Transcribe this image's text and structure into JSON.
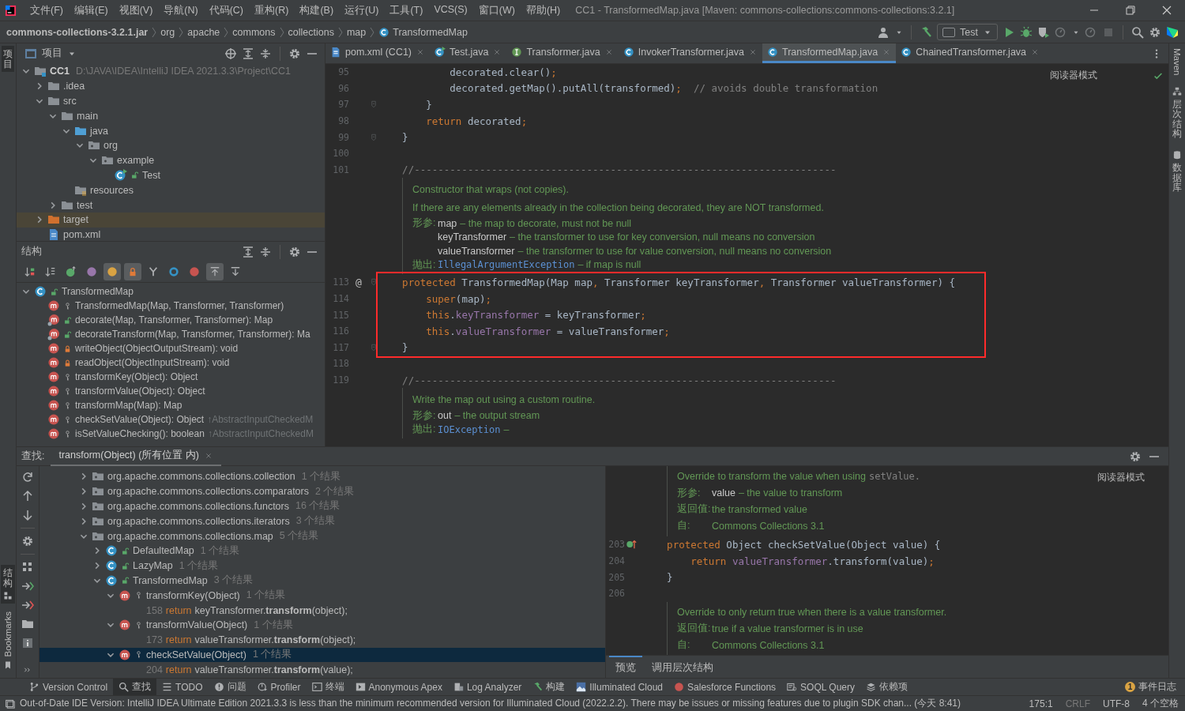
{
  "menu": [
    "文件(F)",
    "编辑(E)",
    "视图(V)",
    "导航(N)",
    "代码(C)",
    "重构(R)",
    "构建(B)",
    "运行(U)",
    "工具(T)",
    "VCS(S)",
    "窗口(W)",
    "帮助(H)"
  ],
  "window_title": "CC1 - TransformedMap.java [Maven: commons-collections:commons-collections:3.2.1]",
  "breadcrumbs": [
    "commons-collections-3.2.1.jar",
    "org",
    "apache",
    "commons",
    "collections",
    "map",
    "TransformedMap"
  ],
  "run_config": "Test",
  "left_top_tabs": [
    {
      "label": "项目",
      "kind": "stacked",
      "selected": true
    }
  ],
  "left_bottom_tabs": [
    {
      "label": "结构",
      "kind": "stacked",
      "selected": true
    },
    {
      "label": "Bookmarks",
      "kind": "rotated",
      "selected": false
    }
  ],
  "right_tabs": [
    {
      "label": "Maven",
      "kind": "rotated",
      "selected": false
    },
    {
      "label": "层次结构",
      "kind": "stacked",
      "selected": false
    },
    {
      "label": "数据库",
      "kind": "stacked",
      "selected": false
    }
  ],
  "project": {
    "title": "项目",
    "tree": [
      {
        "kind": "module",
        "label": "CC1",
        "path": "D:\\JAVA\\IDEA\\IntelliJ IDEA 2021.3.3\\Project\\CC1",
        "expanded": true,
        "selected": false,
        "children": [
          {
            "kind": "folder",
            "label": ".idea",
            "expanded": false,
            "selected": false
          },
          {
            "kind": "folder",
            "label": "src",
            "expanded": true,
            "selected": false,
            "children": [
              {
                "kind": "folder",
                "label": "main",
                "expanded": true,
                "selected": false,
                "children": [
                  {
                    "kind": "source",
                    "label": "java",
                    "expanded": true,
                    "selected": false,
                    "children": [
                      {
                        "kind": "package",
                        "label": "org",
                        "expanded": true,
                        "selected": false,
                        "children": [
                          {
                            "kind": "package",
                            "label": "example",
                            "expanded": true,
                            "selected": false,
                            "children": [
                              {
                                "kind": "runclass",
                                "label": "Test",
                                "public": true,
                                "private": false,
                                "selected": false
                              }
                            ]
                          }
                        ]
                      }
                    ]
                  },
                  {
                    "kind": "resources",
                    "label": "resources",
                    "selected": false
                  }
                ]
              },
              {
                "kind": "folder",
                "label": "test",
                "expanded": false,
                "selected": false
              }
            ]
          },
          {
            "kind": "excluded",
            "label": "target",
            "expanded": false,
            "selected": true
          },
          {
            "kind": "xmlfile",
            "label": "pom.xml",
            "selected": false
          }
        ]
      }
    ]
  },
  "structure": {
    "title": "结构",
    "toolbar": [
      {
        "on": false
      },
      {
        "on": false
      },
      {
        "on": false
      },
      {
        "on": false
      },
      {
        "on": true
      },
      {
        "on": true
      },
      {
        "on": false
      },
      {
        "on": false
      },
      {
        "on": false
      },
      {
        "on": true
      },
      {
        "on": false
      }
    ],
    "tree": [
      {
        "kind": "class",
        "label": "TransformedMap",
        "public": true,
        "private": false,
        "expanded": true,
        "selected": false,
        "children": [
          {
            "kind": "method",
            "label": "TransformedMap(Map, Transformer, Transformer)",
            "public": false,
            "private": false,
            "static": false,
            "selected": false
          },
          {
            "kind": "method",
            "label": "decorate(Map, Transformer, Transformer): Map",
            "public": true,
            "private": false,
            "static": true,
            "selected": false
          },
          {
            "kind": "method",
            "label": "decorateTransform(Map, Transformer, Transformer): Ma",
            "public": true,
            "private": false,
            "static": true,
            "selected": false
          },
          {
            "kind": "method",
            "label": "writeObject(ObjectOutputStream): void",
            "public": false,
            "private": true,
            "static": false,
            "selected": false
          },
          {
            "kind": "method",
            "label": "readObject(ObjectInputStream): void",
            "public": false,
            "private": true,
            "static": false,
            "selected": false
          },
          {
            "kind": "method",
            "label": "transformKey(Object): Object",
            "public": false,
            "private": false,
            "static": false,
            "selected": false
          },
          {
            "kind": "method",
            "label": "transformValue(Object): Object",
            "public": false,
            "private": false,
            "static": false,
            "selected": false
          },
          {
            "kind": "method",
            "label": "transformMap(Map): Map",
            "public": false,
            "private": false,
            "static": false,
            "selected": false
          },
          {
            "kind": "method",
            "label": "checkSetValue(Object): Object",
            "suffix": "↑AbstractInputCheckedM",
            "public": false,
            "private": false,
            "static": false,
            "selected": false
          },
          {
            "kind": "method",
            "label": "isSetValueChecking(): boolean",
            "suffix": "↑AbstractInputCheckedM",
            "public": false,
            "private": false,
            "static": false,
            "selected": false
          }
        ]
      }
    ]
  },
  "editor": {
    "tabs": [
      {
        "label": "pom.xml (CC1)",
        "kind": "xmlfile",
        "selected": false
      },
      {
        "label": "Test.java",
        "kind": "runclass",
        "selected": false
      },
      {
        "label": "Transformer.java",
        "kind": "interface",
        "selected": false
      },
      {
        "label": "InvokerTransformer.java",
        "kind": "class",
        "selected": false
      },
      {
        "label": "TransformedMap.java",
        "kind": "class",
        "selected": true
      },
      {
        "label": "ChainedTransformer.java",
        "kind": "class",
        "selected": false
      }
    ],
    "reader_mode": "阅读器模式",
    "segments": [
      {
        "kind": "code",
        "highlighted": false,
        "lines": [
          {
            "num": "95",
            "text": "            decorated.clear()**;**"
          },
          {
            "num": "96",
            "text": "            decorated.getMap().putAll(transformed)**;**",
            "comment": "  // avoids double transformation"
          },
          {
            "num": "97",
            "fold": true,
            "text": "        }"
          },
          {
            "num": "98",
            "text": "        **return** decorated**;**"
          },
          {
            "num": "99",
            "fold": true,
            "text": "    }"
          },
          {
            "num": "100"
          },
          {
            "num": "101",
            "comment": "    //-----------------------------------------------------------------------"
          }
        ]
      },
      {
        "kind": "doc",
        "items": [
          {
            "kind": "text",
            "text": "Constructor that wraps (not copies)."
          },
          {
            "kind": "text",
            "text": "If there are any elements already in the collection being decorated, they are NOT transformed."
          },
          {
            "kind": "tag",
            "label": "形参:",
            "name": "map",
            "desc": "– the map to decorate, must not be null"
          },
          {
            "kind": "tag",
            "name": "keyTransformer",
            "desc": "– the transformer to use for key conversion, null means no conversion"
          },
          {
            "kind": "tag",
            "name": "valueTransformer",
            "desc": "– the transformer to use for value conversion, null means no conversion"
          },
          {
            "kind": "tag",
            "label": "抛出:",
            "code": "IllegalArgumentException",
            "desc": "– if map is null"
          }
        ]
      },
      {
        "kind": "code",
        "highlighted": true,
        "lines": [
          {
            "num": "113",
            "gutter": "@",
            "fold": true,
            "text": "    **protected** TransformedMap(Map map**,** Transformer keyTransformer**,** Transformer valueTransformer) {"
          },
          {
            "num": "114",
            "text": "        **super**(map)**;**"
          },
          {
            "num": "115",
            "text": "        **this**.*keyTransformer* = keyTransformer**;**"
          },
          {
            "num": "116",
            "text": "        **this**.*valueTransformer* = valueTransformer**;**"
          },
          {
            "num": "117",
            "fold": true,
            "text": "    }"
          }
        ]
      },
      {
        "kind": "code",
        "highlighted": false,
        "lines": [
          {
            "num": "118"
          },
          {
            "num": "119",
            "comment": "    //-----------------------------------------------------------------------"
          }
        ]
      },
      {
        "kind": "doc",
        "items": [
          {
            "kind": "text",
            "text": "Write the map out using a custom routine."
          },
          {
            "kind": "tag",
            "label": "形参:",
            "name": "out",
            "desc": "– the output stream"
          },
          {
            "kind": "tag",
            "label": "抛出:",
            "code": "IOException",
            "desc": "–"
          }
        ]
      }
    ]
  },
  "find": {
    "label": "查找:",
    "tab": "transform(Object) (所有位置 内)",
    "tree": [
      {
        "kind": "package",
        "label": "org.apache.commons.collections.collection",
        "count": "1 个结果",
        "expanded": false,
        "selected": false
      },
      {
        "kind": "package",
        "label": "org.apache.commons.collections.comparators",
        "count": "2 个结果",
        "expanded": false,
        "selected": false
      },
      {
        "kind": "package",
        "label": "org.apache.commons.collections.functors",
        "count": "16 个结果",
        "expanded": false,
        "selected": false
      },
      {
        "kind": "package",
        "label": "org.apache.commons.collections.iterators",
        "count": "3 个结果",
        "expanded": false,
        "selected": false
      },
      {
        "kind": "package",
        "label": "org.apache.commons.collections.map",
        "count": "5 个结果",
        "expanded": true,
        "selected": false,
        "children": [
          {
            "kind": "class",
            "label": "DefaultedMap",
            "public": true,
            "private": false,
            "count": "1 个结果",
            "expanded": false,
            "selected": false
          },
          {
            "kind": "class",
            "label": "LazyMap",
            "public": true,
            "private": false,
            "count": "1 个结果",
            "expanded": false,
            "selected": false
          },
          {
            "kind": "class",
            "label": "TransformedMap",
            "public": true,
            "private": false,
            "count": "3 个结果",
            "expanded": true,
            "selected": false,
            "children": [
              {
                "kind": "method",
                "label": "transformKey(Object)",
                "public": false,
                "private": false,
                "count": "1 个结果",
                "expanded": true,
                "selected": false,
                "children": [
                  {
                    "kind": "result",
                    "line": "158",
                    "keyword": "return",
                    "code": "keyTransformer.**transform**(object);",
                    "selected": false
                  }
                ]
              },
              {
                "kind": "method",
                "label": "transformValue(Object)",
                "public": false,
                "private": false,
                "count": "1 个结果",
                "expanded": true,
                "selected": false,
                "children": [
                  {
                    "kind": "result",
                    "line": "173",
                    "keyword": "return",
                    "code": "valueTransformer.**transform**(object);",
                    "selected": false
                  }
                ]
              },
              {
                "kind": "method",
                "label": "checkSetValue(Object)",
                "public": false,
                "private": false,
                "count": "1 个结果",
                "expanded": true,
                "selected": true,
                "children": [
                  {
                    "kind": "result",
                    "line": "204",
                    "keyword": "return",
                    "code": "valueTransformer.**transform**(value);",
                    "selected": false
                  }
                ]
              }
            ]
          }
        ]
      }
    ],
    "preview": {
      "reader_mode": "阅读器模式",
      "segments": [
        {
          "kind": "doc",
          "items": [
            {
              "kind": "text",
              "text": "Override to transform the value when using",
              "code": "setValue."
            },
            {
              "kind": "tag",
              "label": "形参:",
              "name": "value",
              "desc": "– the value to transform"
            },
            {
              "kind": "tag",
              "label": "返回值:",
              "desc": "the transformed value"
            },
            {
              "kind": "tag",
              "label": "自:",
              "desc": "Commons Collections 3.1"
            }
          ]
        },
        {
          "kind": "code",
          "highlighted": false,
          "lines": [
            {
              "num": "203",
              "overridden": true,
              "text": "    **protected** Object checkSetValue(Object value) {"
            },
            {
              "num": "204",
              "text": "        **return** *valueTransformer*.transform(value)**;**"
            },
            {
              "num": "205",
              "text": "    }"
            },
            {
              "num": "206"
            }
          ]
        },
        {
          "kind": "doc",
          "items": [
            {
              "kind": "text",
              "text": "Override to only return true when there is a value transformer."
            },
            {
              "kind": "tag",
              "label": "返回值:",
              "desc": "true if a value transformer is in use"
            },
            {
              "kind": "tag",
              "label": "自:",
              "desc": "Commons Collections 3.1"
            }
          ]
        }
      ],
      "tabs": [
        {
          "label": "预览",
          "selected": true
        },
        {
          "label": "调用层次结构",
          "selected": false
        }
      ]
    }
  },
  "tool_windows": [
    {
      "label": "Version Control",
      "selected": false
    },
    {
      "label": "查找",
      "selected": true
    },
    {
      "label": "TODO",
      "selected": false
    },
    {
      "label": "问题",
      "selected": false
    },
    {
      "label": "Profiler",
      "selected": false
    },
    {
      "label": "终端",
      "selected": false
    },
    {
      "label": "Anonymous Apex",
      "selected": false
    },
    {
      "label": "Log Analyzer",
      "selected": false
    },
    {
      "label": "构建",
      "selected": false
    },
    {
      "label": "Illuminated Cloud",
      "selected": false
    },
    {
      "label": "Salesforce Functions",
      "selected": false
    },
    {
      "label": "SOQL Query",
      "selected": false
    },
    {
      "label": "依赖项",
      "selected": false
    }
  ],
  "event_log": {
    "label": "事件日志",
    "count": "1"
  },
  "status": {
    "message": "Out-of-Date IDE Version: IntelliJ IDEA Ultimate Edition 2021.3.3 is less than the minimum recommended version for Illuminated Cloud (2022.2.2). There may be issues or missing features due to plugin SDK chan... (今天 8:41)",
    "position": "175:1",
    "line_ending": "CRLF",
    "encoding": "UTF-8",
    "indent": "4 个空格"
  }
}
